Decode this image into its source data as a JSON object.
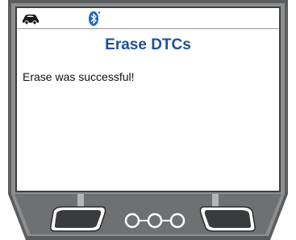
{
  "screen": {
    "title": "Erase DTCs",
    "message": "Erase was successful!"
  },
  "status_bar": {
    "icons": [
      "car-icon",
      "bluetooth-icon"
    ]
  },
  "colors": {
    "title": "#1e4f9c",
    "bezel_dark": "#4a4a4c",
    "bezel_mid": "#6d6e70",
    "bezel_light": "#9b9c9e"
  }
}
